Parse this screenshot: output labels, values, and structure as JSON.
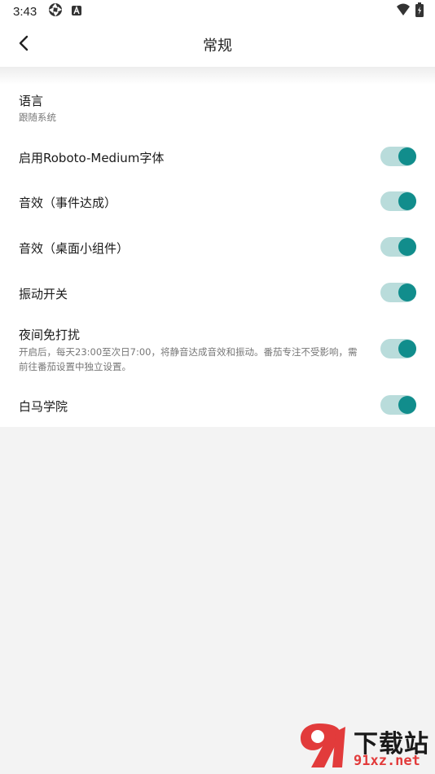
{
  "status_bar": {
    "time": "3:43",
    "left_icons": [
      "aperture-icon",
      "app-notification-icon"
    ],
    "right_icons": [
      "wifi-icon",
      "battery-charging-icon"
    ]
  },
  "app_bar": {
    "title": "常规",
    "back_icon": "chevron-left-icon"
  },
  "settings": {
    "language": {
      "title": "语言",
      "subtitle": "跟随系统"
    },
    "roboto": {
      "title": "启用Roboto-Medium字体",
      "enabled": true
    },
    "sound_event": {
      "title": "音效（事件达成）",
      "enabled": true
    },
    "sound_widget": {
      "title": "音效（桌面小组件）",
      "enabled": true
    },
    "vibration": {
      "title": "振动开关",
      "enabled": true
    },
    "night_dnd": {
      "title": "夜间免打扰",
      "subtitle": "开启后，每天23:00至次日7:00，将静音达成音效和振动。番茄专注不受影响，需前往番茄设置中独立设置。",
      "enabled": true
    },
    "baima": {
      "title": "白马学院",
      "enabled": true
    }
  },
  "colors": {
    "accent": "#118d8c",
    "track": "#b9dcdb",
    "background": "#f3f3f3"
  },
  "watermark": {
    "top_text": "下载站",
    "bottom_text": "91xz.net"
  }
}
